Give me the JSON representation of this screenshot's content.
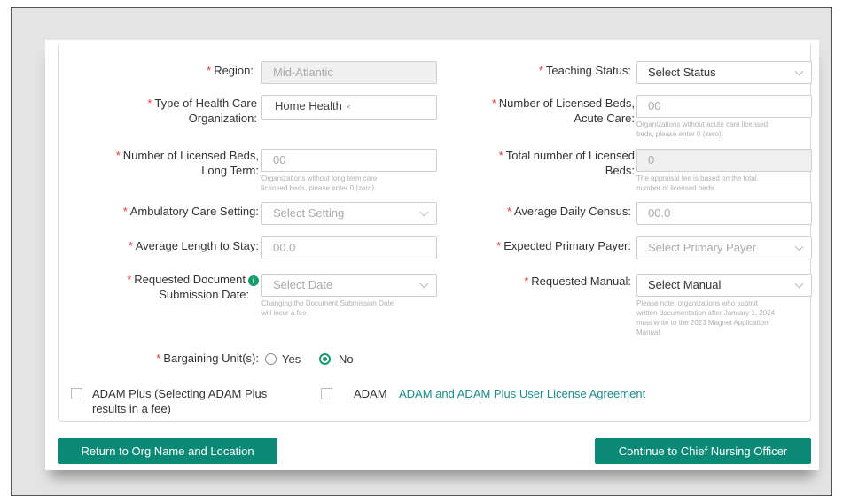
{
  "form": {
    "region": {
      "label": "Region:",
      "value": "Mid-Atlantic"
    },
    "teaching_status": {
      "label": "Teaching Status:",
      "value": "Select Status"
    },
    "org_type": {
      "label_line1": "Type of Health Care",
      "label_line2": "Organization:",
      "tag": "Home Health",
      "tag_remove": "×"
    },
    "beds_acute": {
      "label_line1": "Number of Licensed Beds,",
      "label_line2": "Acute Care:",
      "placeholder": "00",
      "help": [
        "Organizations without acute care licensed",
        "beds, please enter 0 (zero)."
      ]
    },
    "beds_long": {
      "label_line1": "Number of Licensed Beds,",
      "label_line2": "Long Term:",
      "placeholder": "00",
      "help": [
        "Organizations without long term care",
        "licensed beds, please enter 0 (zero)."
      ]
    },
    "beds_total": {
      "label_line1": "Total number of Licensed",
      "label_line2": "Beds:",
      "value": "0",
      "help": [
        "The appraisal fee is based on the total",
        "number of licensed beds."
      ]
    },
    "ambulatory": {
      "label": "Ambulatory Care Setting:",
      "placeholder": "Select Setting"
    },
    "avg_census": {
      "label": "Average Daily Census:",
      "placeholder": "00.0"
    },
    "avg_length": {
      "label": "Average Length to Stay:",
      "placeholder": "00.0"
    },
    "primary_payer": {
      "label": "Expected Primary Payer:",
      "placeholder": "Select Primary Payer"
    },
    "submission_date": {
      "label_line1": "Requested Document",
      "label_line2": "Submission Date:",
      "placeholder": "Select Date",
      "info": "i",
      "help": [
        "Changing the Document Submission Date",
        "will incur a fee."
      ]
    },
    "manual": {
      "label": "Requested Manual:",
      "value": "Select Manual",
      "help": [
        "Please note: organizations who submit",
        "written documentation after January 1, 2024",
        "must write to the 2023 Magnet Application",
        "Manual."
      ]
    },
    "bargaining": {
      "label": "Bargaining Unit(s):",
      "yes": "Yes",
      "no": "No",
      "selected": "No"
    },
    "adam_plus": {
      "line1": "ADAM Plus (Selecting ADAM Plus",
      "line2": "results in a fee)"
    },
    "adam": {
      "label": "ADAM"
    },
    "license_link": "ADAM and ADAM Plus User License Agreement"
  },
  "buttons": {
    "back": "Return to Org Name and Location",
    "next": "Continue to Chief Nursing Officer"
  },
  "required_marker": "*",
  "colors": {
    "accent": "#0a8a76",
    "required": "#e53935",
    "link": "#1a8a8a"
  }
}
